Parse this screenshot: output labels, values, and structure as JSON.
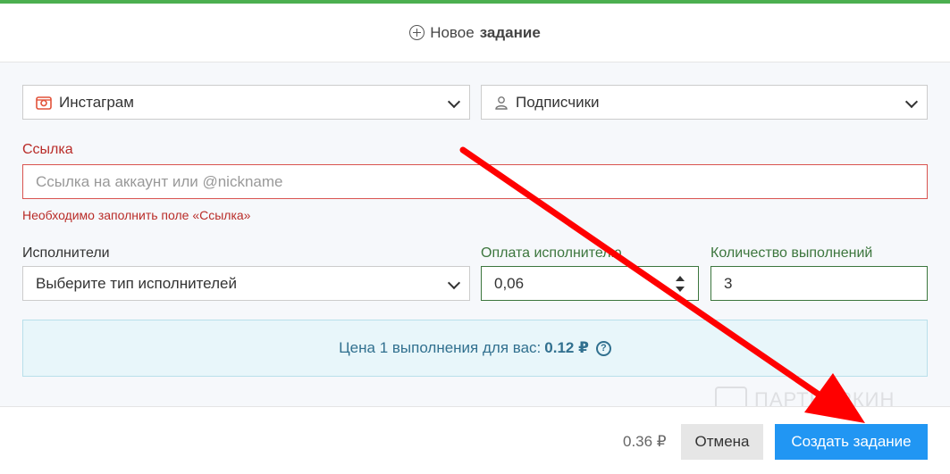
{
  "header": {
    "title_prefix": "Новое",
    "title_bold": "задание"
  },
  "platform_select": {
    "value": "Инстаграм"
  },
  "type_select": {
    "value": "Подписчики"
  },
  "link_field": {
    "label": "Ссылка",
    "placeholder": "Ссылка на аккаунт или @nickname",
    "error": "Необходимо заполнить поле «Ссылка»"
  },
  "performers_field": {
    "label": "Исполнители",
    "value": "Выберите тип исполнителей"
  },
  "payment_field": {
    "label": "Оплата исполнителю",
    "value": "0,06"
  },
  "count_field": {
    "label": "Количество выполнений",
    "value": "3"
  },
  "info": {
    "text": "Цена 1 выполнения для вас:",
    "price": "0.12 ₽",
    "help": "?"
  },
  "footer": {
    "total": "0.36 ₽",
    "cancel_label": "Отмена",
    "create_label": "Создать задание"
  },
  "watermark": {
    "text": "ПАРТНЕРКИН"
  },
  "colors": {
    "accent": "#2196f3",
    "error": "#b92c28",
    "success": "#3c763d",
    "arrow": "#ff0000"
  }
}
